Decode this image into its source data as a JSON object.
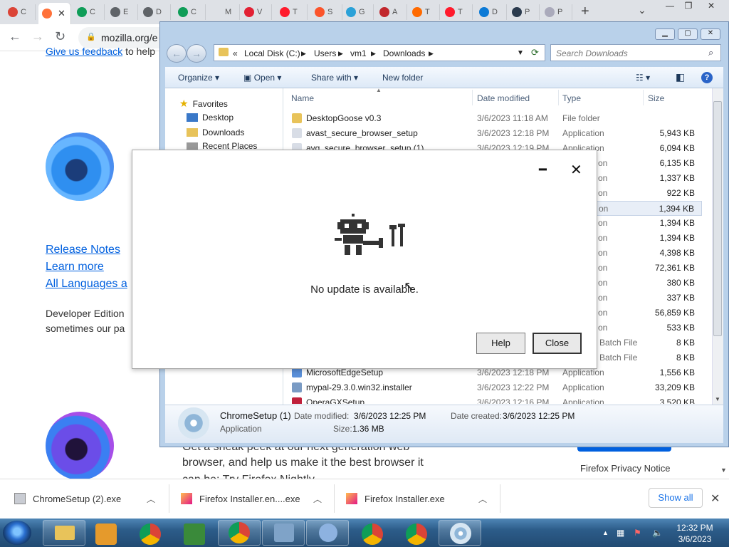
{
  "browser": {
    "tabs": [
      {
        "label": "C",
        "color": "#db4437"
      },
      {
        "label": "",
        "color": "#ff7139",
        "active": true
      },
      {
        "label": "C",
        "color": "#0f9d58"
      },
      {
        "label": "E",
        "color": "#5f6368"
      },
      {
        "label": "D",
        "color": "#5f6368"
      },
      {
        "label": "C",
        "color": "#0f9d58"
      },
      {
        "label": "M",
        "color": "#dee1e6"
      },
      {
        "label": "V",
        "color": "#e22134"
      },
      {
        "label": "T",
        "color": "#ff1b2d"
      },
      {
        "label": "S",
        "color": "#fb542b"
      },
      {
        "label": "G",
        "color": "#2aa1d8"
      },
      {
        "label": "A",
        "color": "#c1272d"
      },
      {
        "label": "T",
        "color": "#ff6a00"
      },
      {
        "label": "T",
        "color": "#ff1b2d"
      },
      {
        "label": "D",
        "color": "#0c7ad6"
      },
      {
        "label": "P",
        "color": "#2b3b4e"
      },
      {
        "label": "P",
        "color": "#aab"
      }
    ],
    "new_tab": "+",
    "url": "mozilla.org/e"
  },
  "webpage": {
    "feedback_link": "Give us feedback",
    "feedback_suffix": "to help",
    "links": [
      "Release Notes",
      "Learn more",
      "All Languages a"
    ],
    "developer_line1": "Developer Edition",
    "developer_line2": "sometimes our pa",
    "nightly_line1": "Get a sneak peek at our next generation web",
    "nightly_line2": "browser, and help us make it the best browser it",
    "nightly_line3": "can be: Try Firefox Nightly.",
    "privacy_notice": "Firefox Privacy Notice"
  },
  "downloads_bar": {
    "items": [
      "ChromeSetup (2).exe",
      "Firefox Installer.en....exe",
      "Firefox Installer.exe"
    ],
    "show_all": "Show all"
  },
  "explorer": {
    "breadcrumbs": [
      "«",
      "Local Disk (C:)",
      "Users",
      "vm1",
      "Downloads"
    ],
    "search_placeholder": "Search Downloads",
    "commands": {
      "organize": "Organize",
      "open": "Open",
      "share": "Share with",
      "new_folder": "New folder"
    },
    "nav": [
      "Favorites",
      "Desktop",
      "Downloads",
      "Recent Places"
    ],
    "columns": {
      "name": "Name",
      "date": "Date modified",
      "type": "Type",
      "size": "Size"
    },
    "rows": [
      {
        "name": "DesktopGoose v0.3",
        "date": "3/6/2023 11:18 AM",
        "type": "File folder",
        "size": ""
      },
      {
        "name": "avast_secure_browser_setup",
        "date": "3/6/2023 12:18 PM",
        "type": "Application",
        "size": "5,943 KB"
      },
      {
        "name": "avg_secure_browser_setup (1)",
        "date": "3/6/2023 12:19 PM",
        "type": "Application",
        "size": "6,094 KB"
      },
      {
        "name": "",
        "date": "",
        "type": "on",
        "size": "6,135 KB"
      },
      {
        "name": "",
        "date": "",
        "type": "on",
        "size": "1,337 KB"
      },
      {
        "name": "",
        "date": "",
        "type": "on",
        "size": "922 KB"
      },
      {
        "name": "",
        "date": "",
        "type": "on",
        "size": "1,394 KB"
      },
      {
        "name": "",
        "date": "",
        "type": "on",
        "size": "1,394 KB"
      },
      {
        "name": "",
        "date": "",
        "type": "on",
        "size": "1,394 KB"
      },
      {
        "name": "",
        "date": "",
        "type": "on",
        "size": "4,398 KB"
      },
      {
        "name": "",
        "date": "",
        "type": "on",
        "size": "72,361 KB"
      },
      {
        "name": "",
        "date": "",
        "type": "on",
        "size": "380 KB"
      },
      {
        "name": "",
        "date": "",
        "type": "on",
        "size": "337 KB"
      },
      {
        "name": "",
        "date": "",
        "type": "on",
        "size": "56,859 KB"
      },
      {
        "name": "",
        "date": "",
        "type": "on",
        "size": "533 KB"
      },
      {
        "name": "",
        "date": "",
        "type": "Batch File",
        "size": "8 KB"
      },
      {
        "name": "",
        "date": "",
        "type": "Batch File",
        "size": "8 KB"
      },
      {
        "name": "MicrosoftEdgeSetup",
        "date": "3/6/2023 12:18 PM",
        "type": "Application",
        "size": "1,556 KB"
      },
      {
        "name": "mypal-29.3.0.win32.installer",
        "date": "3/6/2023 12:22 PM",
        "type": "Application",
        "size": "33,209 KB"
      },
      {
        "name": "OperaGXSetup",
        "date": "3/6/2023 12:16 PM",
        "type": "Application",
        "size": "3,520 KB"
      }
    ],
    "details": {
      "name": "ChromeSetup (1)",
      "type": "Application",
      "date_modified_label": "Date modified:",
      "date_modified": "3/6/2023 12:25 PM",
      "date_created_label": "Date created:",
      "date_created": "3/6/2023 12:25 PM",
      "size_label": "Size:",
      "size": "1.36 MB"
    }
  },
  "dialog": {
    "message": "No update is available.",
    "help": "Help",
    "close": "Close"
  },
  "taskbar": {
    "time": "12:32 PM",
    "date": "3/6/2023"
  }
}
